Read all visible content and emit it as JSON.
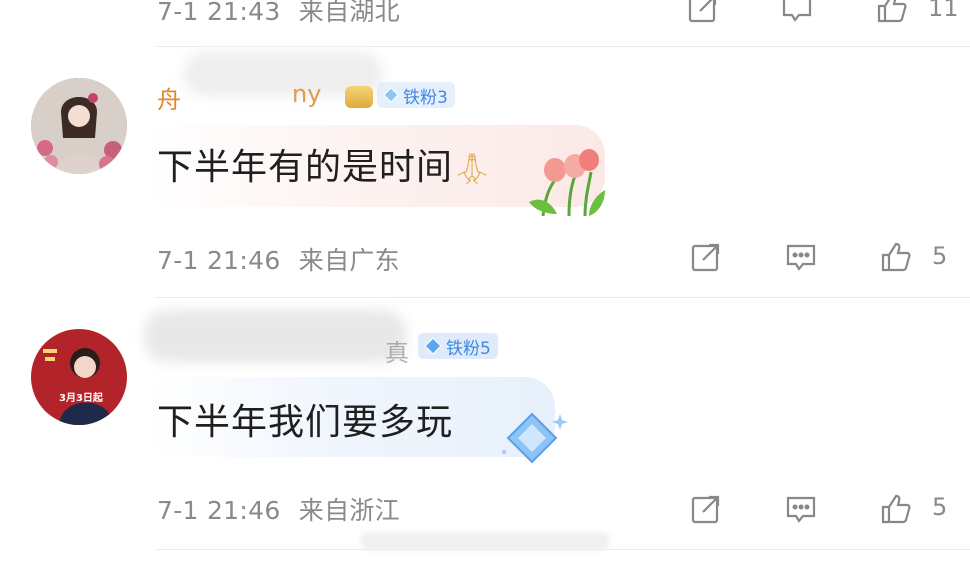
{
  "comments": [
    {
      "meta": {
        "time": "7-1 21:43",
        "location": "来自湖北",
        "likes": "11"
      }
    },
    {
      "username": "舟",
      "username_tail": "ny",
      "fan_badge": "铁粉3",
      "text": "下半年有的是时间",
      "meta": {
        "time": "7-1 21:46",
        "location": "来自广东",
        "likes": "5"
      }
    },
    {
      "username_tail": "真",
      "fan_badge": "铁粉5",
      "avatar_caption": "3月3日起",
      "text": "下半年我们要多玩",
      "meta": {
        "time": "7-1 21:46",
        "location": "来自浙江",
        "likes": "5"
      }
    }
  ],
  "icons": [
    "share-icon",
    "reply-icon",
    "like-icon",
    "fan-badge-icon",
    "sticker-decoration"
  ],
  "colors": {
    "meta_gray": "#8a8a8a",
    "badge_blue": "#3f8ae0",
    "badge_bg": "#e6f0fc",
    "username_orange": "#e08a2c"
  }
}
